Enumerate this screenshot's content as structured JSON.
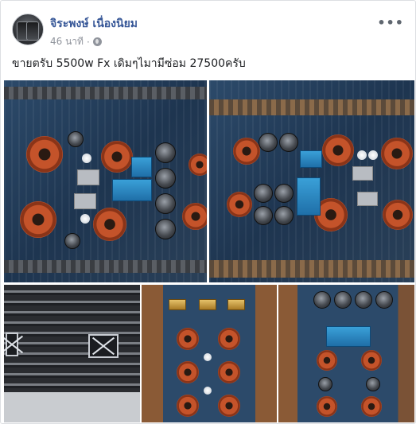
{
  "post": {
    "author_name": "จิระพงษ์ เนื่องนิยม",
    "timestamp": "46 นาที",
    "separator": "·",
    "privacy_icon": "globe-icon",
    "more_label": "•••",
    "caption": "ขายตรับ 5500w Fx เดิมๆไมามีซ่อม 27500ครับ"
  },
  "photos": [
    {
      "id": "photo-1",
      "subject": "amplifier-board"
    },
    {
      "id": "photo-2",
      "subject": "amplifier-board"
    },
    {
      "id": "photo-3",
      "subject": "amplifier-grille"
    },
    {
      "id": "photo-4",
      "subject": "amplifier-board"
    },
    {
      "id": "photo-5",
      "subject": "amplifier-board"
    }
  ],
  "colors": {
    "author_link": "#385898",
    "meta_text": "#90949c",
    "body_text": "#1c1e21"
  }
}
